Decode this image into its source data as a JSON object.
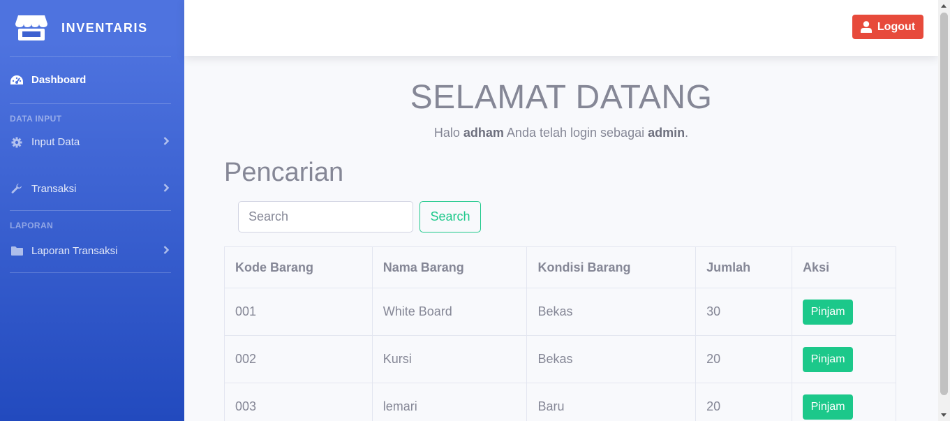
{
  "app": {
    "brand": "INVENTARIS"
  },
  "sidebar": {
    "dashboard": "Dashboard",
    "section_input": "DATA INPUT",
    "input_data": "Input Data",
    "transaksi": "Transaksi",
    "section_laporan": "LAPORAN",
    "laporan_transaksi": "Laporan Transaksi"
  },
  "topbar": {
    "logout": "Logout"
  },
  "welcome": {
    "title": "SELAMAT DATANG",
    "prefix": "Halo ",
    "username": "adham",
    "middle": " Anda telah login sebagai ",
    "role": "admin",
    "suffix": "."
  },
  "search": {
    "title": "Pencarian",
    "placeholder": "Search",
    "button": "Search"
  },
  "table": {
    "headers": [
      "Kode Barang",
      "Nama Barang",
      "Kondisi Barang",
      "Jumlah",
      "Aksi"
    ],
    "rows": [
      {
        "kode": "001",
        "nama": "White Board",
        "kondisi": "Bekas",
        "jumlah": "30",
        "aksi": "Pinjam"
      },
      {
        "kode": "002",
        "nama": "Kursi",
        "kondisi": "Bekas",
        "jumlah": "20",
        "aksi": "Pinjam"
      },
      {
        "kode": "003",
        "nama": "lemari",
        "kondisi": "Baru",
        "jumlah": "20",
        "aksi": "Pinjam"
      }
    ]
  },
  "colors": {
    "sidebar_top": "#4e73df",
    "sidebar_bottom": "#224abe",
    "logout": "#e74a3b",
    "success": "#1cc88a",
    "text_muted": "#858796"
  }
}
